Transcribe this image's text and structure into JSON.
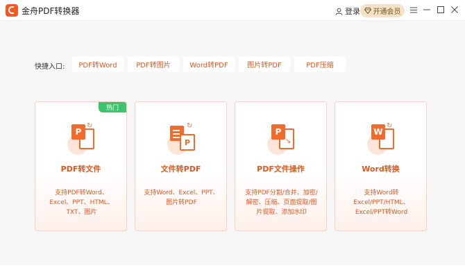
{
  "app": {
    "title": "金舟PDF转换器"
  },
  "header": {
    "login_label": "登录",
    "vip_label": "开通会员"
  },
  "quick": {
    "label": "快捷入口:",
    "items": [
      "PDF转Word",
      "PDF转图片",
      "Word转PDF",
      "图片转PDF",
      "PDF压缩"
    ]
  },
  "cards": [
    {
      "title": "PDF转文件",
      "desc": "支持PDF转Word、Excel、PPT、HTML、TXT、图片",
      "badge": "热门",
      "icon_letter": "P"
    },
    {
      "title": "文件转PDF",
      "desc": "支持Word、Excel、PPT、图片转PDF",
      "icon_letter": "P"
    },
    {
      "title": "PDF文件操作",
      "desc": "支持PDF分割/合并、加密/解密、压缩、页面提取/图片提取、添加水印",
      "icon_letter": "P"
    },
    {
      "title": "Word转换",
      "desc": "支持Word转Excel/PPT/HTML、Excel/PPT转Word",
      "icon_letter": "W"
    }
  ],
  "colors": {
    "accent": "#e0561c",
    "icon": "#f26a2c",
    "hot_badge": "#3cc36b",
    "vip_bg": "#f3e2c6",
    "content_bg": "#f6f6f6"
  },
  "icons": {
    "logo": "app-logo-icon",
    "login": "user-icon",
    "vip": "diamond-icon",
    "menu": "menu-icon",
    "minimize": "minimize-icon",
    "maximize": "maximize-icon",
    "close": "close-icon"
  }
}
